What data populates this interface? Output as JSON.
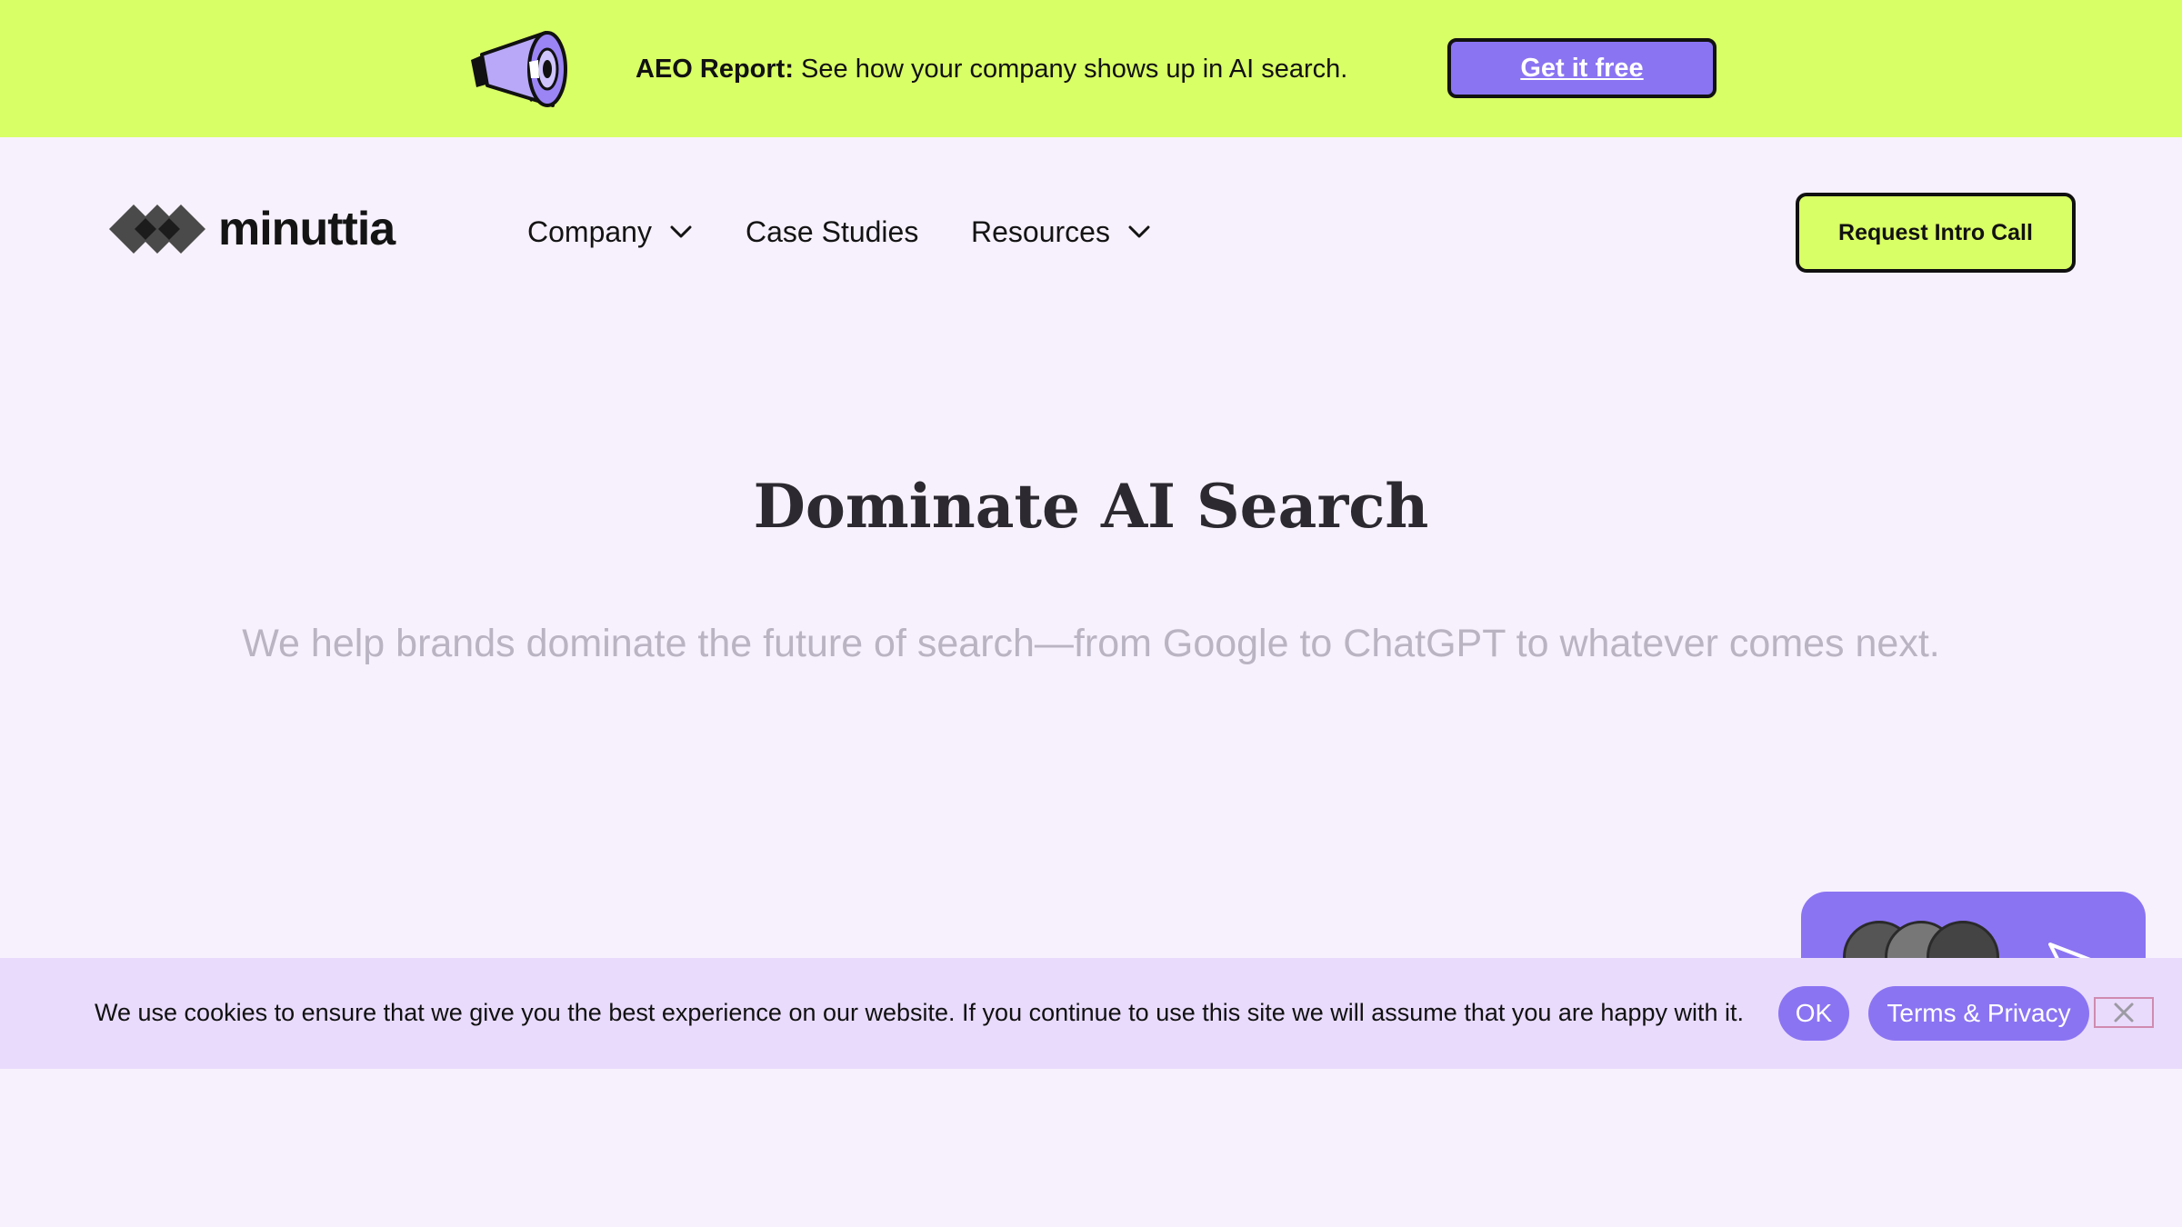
{
  "colors": {
    "promo_bg": "#d9ff66",
    "page_bg": "#f7f1fd",
    "accent_purple": "#8b74f2",
    "cookie_bg": "#e9dbfc",
    "hero_title": "#2c2a30",
    "hero_subtitle": "#b9b3c2"
  },
  "promo": {
    "icon": "megaphone-icon",
    "label_bold": "AEO Report:",
    "label_rest": " See how your company shows up in AI search.",
    "cta": "Get it free"
  },
  "header": {
    "logo_icon": "diamonds-logo-icon",
    "logo_text": "minuttia",
    "nav": [
      {
        "label": "Company",
        "icon": "chevron-down-icon"
      },
      {
        "label": "Case Studies"
      },
      {
        "label": "Resources",
        "icon": "chevron-down-icon"
      }
    ],
    "cta": "Request Intro Call"
  },
  "hero": {
    "title": "Dominate AI Search",
    "subtitle": "We help brands dominate the future of search—from Google to ChatGPT to whatever comes next."
  },
  "chat_widget": {
    "icon": "send-icon",
    "avatars": 3
  },
  "cookie": {
    "text": "We use cookies to ensure that we give you the best experience on our website. If you continue to use this site we will assume that you are happy with it.",
    "ok": "OK",
    "terms": "Terms & Privacy",
    "close_icon": "close-icon"
  }
}
